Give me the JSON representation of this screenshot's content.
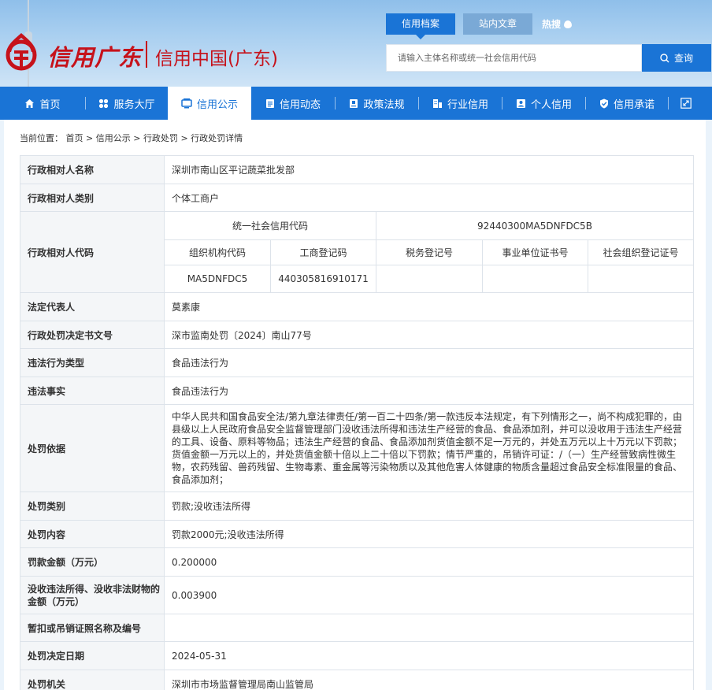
{
  "site": {
    "logo_text": "信用广东",
    "site_name": "信用中国(广东)"
  },
  "search": {
    "tabs": [
      "信用档案",
      "站内文章"
    ],
    "hot_label": "热搜",
    "placeholder": "请输入主体名称或统一社会信用代码",
    "button_label": "查询"
  },
  "nav": {
    "items": [
      {
        "label": "首页",
        "icon": "home-icon"
      },
      {
        "label": "服务大厅",
        "icon": "grid-icon"
      },
      {
        "label": "信用公示",
        "icon": "monitor-icon"
      },
      {
        "label": "信用动态",
        "icon": "document-icon"
      },
      {
        "label": "政策法规",
        "icon": "book-icon"
      },
      {
        "label": "行业信用",
        "icon": "building-icon"
      },
      {
        "label": "个人信用",
        "icon": "person-card-icon"
      },
      {
        "label": "信用承诺",
        "icon": "shield-icon"
      }
    ],
    "active_index": 2,
    "accent_color": "#1a74d6"
  },
  "breadcrumb": {
    "prefix": "当前位置：",
    "items": [
      "首页",
      "信用公示",
      "行政处罚",
      "行政处罚详情"
    ],
    "separator": ">"
  },
  "detail": {
    "name_label": "行政相对人名称",
    "name_value": "深圳市南山区平记蔬菜批发部",
    "type_label": "行政相对人类别",
    "type_value": "个体工商户",
    "code_label": "行政相对人代码",
    "code_headers": {
      "uscc": "统一社会信用代码",
      "org": "组织机构代码",
      "biz_reg": "工商登记码",
      "tax": "税务登记号",
      "inst": "事业单位证书号",
      "social": "社会组织登记证号"
    },
    "code_values": {
      "uscc": "92440300MA5DNFDC5B",
      "org": "MA5DNFDC5",
      "biz_reg": "440305816910171",
      "tax": "",
      "inst": "",
      "social": ""
    },
    "legal_rep_label": "法定代表人",
    "legal_rep_value": "莫素康",
    "doc_no_label": "行政处罚决定书文号",
    "doc_no_value": "深市监南处罚〔2024〕南山77号",
    "violation_type_label": "违法行为类型",
    "violation_type_value": "食品违法行为",
    "violation_fact_label": "违法事实",
    "violation_fact_value": "食品违法行为",
    "basis_label": "处罚依据",
    "basis_value": "中华人民共和国食品安全法/第九章法律责任/第一百二十四条/第一款违反本法规定，有下列情形之一，尚不构成犯罪的，由县级以上人民政府食品安全监督管理部门没收违法所得和违法生产经营的食品、食品添加剂，并可以没收用于违法生产经营的工具、设备、原料等物品；违法生产经营的食品、食品添加剂货值金额不足一万元的，并处五万元以上十万元以下罚款；货值金额一万元以上的，并处货值金额十倍以上二十倍以下罚款；情节严重的，吊销许可证：/（一）生产经营致病性微生物，农药残留、兽药残留、生物毒素、重金属等污染物质以及其他危害人体健康的物质含量超过食品安全标准限量的食品、食品添加剂；",
    "category_label": "处罚类别",
    "category_value": "罚款;没收违法所得",
    "content_label": "处罚内容",
    "content_value": "罚款2000元;没收违法所得",
    "fine_label": "罚款金额（万元）",
    "fine_value": "0.200000",
    "confiscation_label": "没收违法所得、没收非法财物的金额（万元）",
    "confiscation_value": "0.003900",
    "license_label": "暂扣或吊销证照名称及编号",
    "license_value": "",
    "date_label": "处罚决定日期",
    "date_value": "2024-05-31",
    "authority_label": "处罚机关",
    "authority_value": "深圳市市场监督管理局南山监管局"
  }
}
